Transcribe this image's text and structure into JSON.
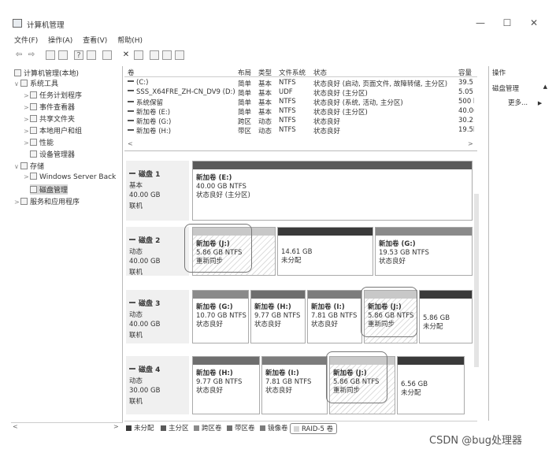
{
  "window": {
    "title": "计算机管理",
    "minimize": "—",
    "maximize": "☐",
    "close": "✕"
  },
  "menu": [
    "文件(F)",
    "操作(A)",
    "查看(V)",
    "帮助(H)"
  ],
  "tree": {
    "root": "计算机管理(本地)",
    "system_tools": "系统工具",
    "task_scheduler": "任务计划程序",
    "event_viewer": "事件查看器",
    "shared_folders": "共享文件夹",
    "local_users": "本地用户和组",
    "performance": "性能",
    "device_manager": "设备管理器",
    "storage": "存储",
    "windows_server_backup": "Windows Server Back",
    "disk_management": "磁盘管理",
    "services_apps": "服务和应用程序"
  },
  "volume_table": {
    "headers": [
      "卷",
      "布局",
      "类型",
      "文件系统",
      "状态",
      "容量"
    ],
    "rows": [
      {
        "volume": "(C:)",
        "layout": "简单",
        "type": "基本",
        "fs": "NTFS",
        "status": "状态良好 (启动, 页面文件, 故障转储, 主分区)",
        "capacity": "39.5"
      },
      {
        "volume": "SSS_X64FRE_ZH-CN_DV9 (D:)",
        "layout": "简单",
        "type": "基本",
        "fs": "UDF",
        "status": "状态良好 (主分区)",
        "capacity": "5.05"
      },
      {
        "volume": "系统保留",
        "layout": "简单",
        "type": "基本",
        "fs": "NTFS",
        "status": "状态良好 (系统, 活动, 主分区)",
        "capacity": "500 l"
      },
      {
        "volume": "新加卷 (E:)",
        "layout": "简单",
        "type": "基本",
        "fs": "NTFS",
        "status": "状态良好 (主分区)",
        "capacity": "40.0("
      },
      {
        "volume": "新加卷 (G:)",
        "layout": "跨区",
        "type": "动态",
        "fs": "NTFS",
        "status": "状态良好",
        "capacity": "30.2:"
      },
      {
        "volume": "新加卷 (H:)",
        "layout": "带区",
        "type": "动态",
        "fs": "NTFS",
        "status": "状态良好",
        "capacity": "19.5l"
      }
    ]
  },
  "disks": [
    {
      "name": "磁盘 1",
      "kind": "基本",
      "size": "40.00 GB",
      "state": "联机",
      "partitions": [
        {
          "name": "新加卷 (E:)",
          "size": "40.00 GB NTFS",
          "status": "状态良好 (主分区)"
        }
      ]
    },
    {
      "name": "磁盘 2",
      "kind": "动态",
      "size": "40.00 GB",
      "state": "联机",
      "partitions": [
        {
          "name": "新加卷 (J:)",
          "size": "5.86 GB NTFS",
          "status": "重新同步"
        },
        {
          "name": "",
          "size": "14.61 GB",
          "status": "未分配"
        },
        {
          "name": "新加卷 (G:)",
          "size": "19.53 GB NTFS",
          "status": "状态良好"
        }
      ]
    },
    {
      "name": "磁盘 3",
      "kind": "动态",
      "size": "40.00 GB",
      "state": "联机",
      "partitions": [
        {
          "name": "新加卷 (G:)",
          "size": "10.70 GB NTFS",
          "status": "状态良好"
        },
        {
          "name": "新加卷 (H:)",
          "size": "9.77 GB NTFS",
          "status": "状态良好"
        },
        {
          "name": "新加卷 (I:)",
          "size": "7.81 GB NTFS",
          "status": "状态良好"
        },
        {
          "name": "新加卷 (J:)",
          "size": "5.86 GB NTFS",
          "status": "重新同步"
        },
        {
          "name": "",
          "size": "5.86 GB",
          "status": "未分配"
        }
      ]
    },
    {
      "name": "磁盘 4",
      "kind": "动态",
      "size": "30.00 GB",
      "state": "联机",
      "partitions": [
        {
          "name": "新加卷 (H:)",
          "size": "9.77 GB NTFS",
          "status": "状态良好"
        },
        {
          "name": "新加卷 (I:)",
          "size": "7.81 GB NTFS",
          "status": "状态良好"
        },
        {
          "name": "新加卷 (J:)",
          "size": "5.86 GB NTFS",
          "status": "重新同步"
        },
        {
          "name": "",
          "size": "6.56 GB",
          "status": "未分配"
        }
      ]
    }
  ],
  "legend": [
    "未分配",
    "主分区",
    "跨区卷",
    "带区卷",
    "镜像卷",
    "RAID-5 卷"
  ],
  "actions": {
    "header": "操作",
    "section": "磁盘管理",
    "more": "更多...",
    "section_arrow": "▲",
    "more_arrow": "▶"
  },
  "watermark": "CSDN @bug处理器",
  "colors": {
    "unallocated": "#3a3a3a",
    "primary": "#5a5a5a",
    "spanned": "#8a8a8a",
    "striped": "#6e6e6e",
    "mirrored": "#7c7c7c",
    "raid5": "#d6d6d6"
  }
}
